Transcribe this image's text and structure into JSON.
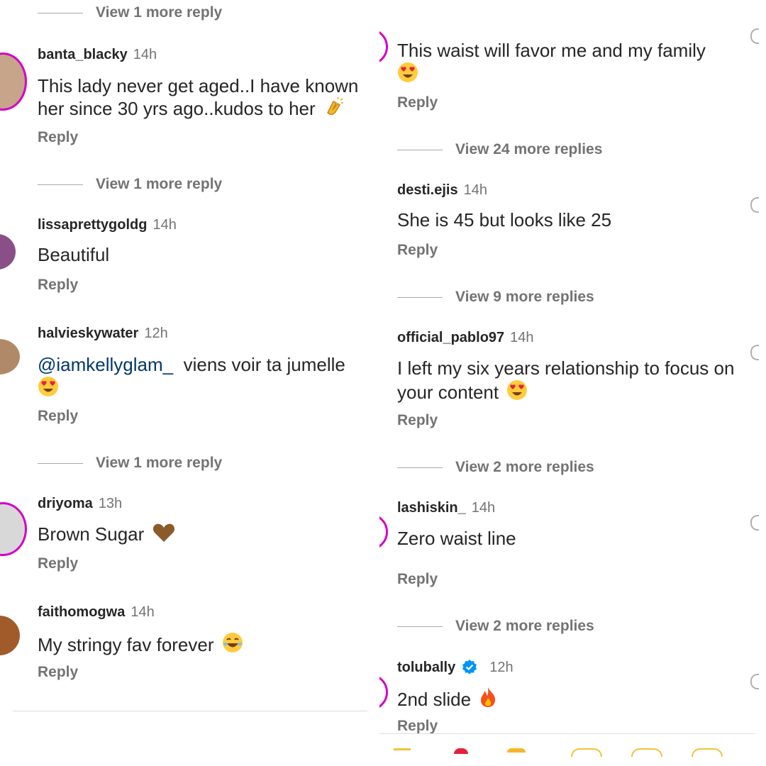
{
  "left_comments": [
    {
      "username": "banta_blacky",
      "time": "14h",
      "text": "This lady never get aged..I have known her since 30 yrs ago..kudos to her",
      "emoji": "clap",
      "reply": "Reply",
      "more": "View 1 more reply"
    },
    {
      "username": "lissaprettygoldg",
      "time": "14h",
      "text": "Beautiful",
      "reply": "Reply"
    },
    {
      "username": "halvieskywater",
      "time": "12h",
      "mention": "@iamkellyglam_",
      "text": "viens voir ta jumelle",
      "emoji": "heart-eyes",
      "reply": "Reply",
      "more": "View 1 more reply"
    },
    {
      "username": "driyoma",
      "time": "13h",
      "text": "Brown Sugar",
      "emoji": "brown-heart",
      "reply": "Reply"
    },
    {
      "username": "faithomogwa",
      "time": "14h",
      "text": "My stringy fav forever",
      "emoji": "laughing-face",
      "reply": "Reply"
    }
  ],
  "left_top_more": "View 1 more reply",
  "right_comments": [
    {
      "text": "This waist will favor me and my family",
      "emoji": "heart-eyes",
      "reply": "Reply",
      "more": "View 24 more replies"
    },
    {
      "username": "desti.ejis",
      "time": "14h",
      "text": "She is 45 but looks like 25",
      "reply": "Reply",
      "more": "View 9 more replies"
    },
    {
      "username": "official_pablo97",
      "time": "14h",
      "text": "I left my six years relationship to focus on your content",
      "emoji": "heart-eyes",
      "reply": "Reply",
      "more": "View 2 more replies"
    },
    {
      "username": "lashiskin_",
      "time": "14h",
      "text": "Zero waist line",
      "reply": "Reply",
      "more": "View 2 more replies"
    },
    {
      "username": "tolubally",
      "verified": true,
      "time": "12h",
      "text": "2nd slide",
      "emoji": "fire",
      "reply": "Reply"
    }
  ],
  "colors": {
    "text": "#262626",
    "muted": "#737373",
    "mention": "#00376b",
    "verified": "#0095f6",
    "story_ring": "#d300c5"
  }
}
